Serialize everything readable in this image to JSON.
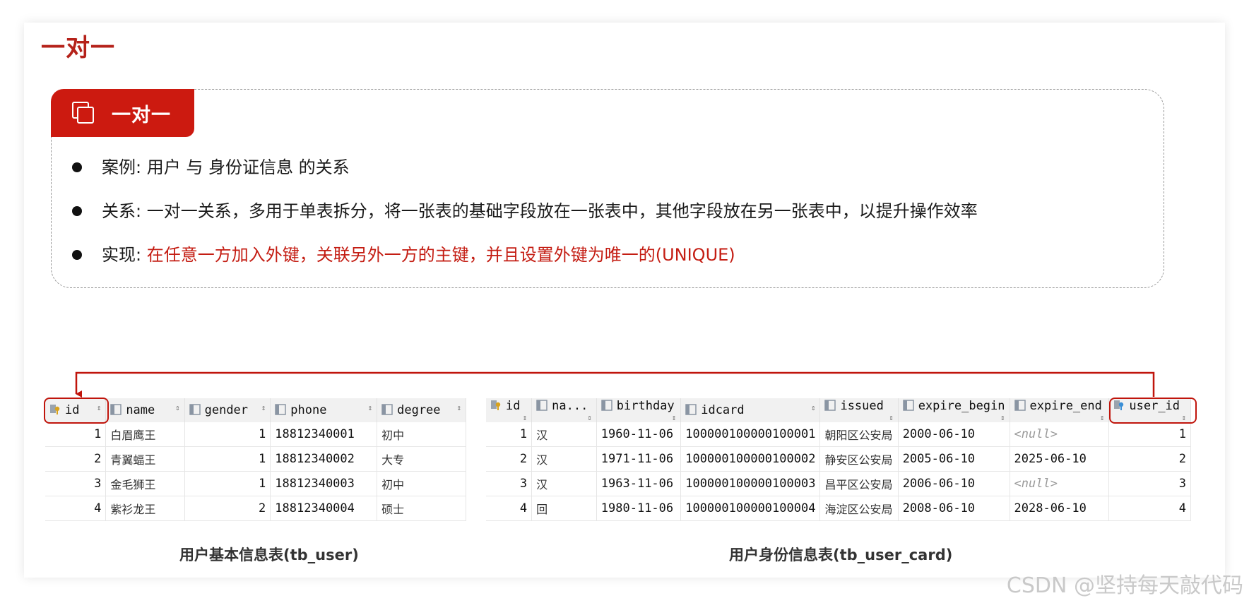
{
  "slide": {
    "title": "一对一",
    "card_label": "一对一",
    "bullets": [
      {
        "prefix": "案例: ",
        "text": "用户 与 身份证信息 的关系",
        "highlight": ""
      },
      {
        "prefix": "关系: ",
        "text": "一对一关系，多用于单表拆分，将一张表的基础字段放在一张表中，其他字段放在另一张表中，以提升操作效率",
        "highlight": ""
      },
      {
        "prefix": "实现: ",
        "text": "",
        "highlight": "在任意一方加入外键，关联另外一方的主键，并且设置外键为唯一的(UNIQUE)"
      }
    ]
  },
  "tb_user": {
    "caption": "用户基本信息表(tb_user)",
    "columns": [
      "id",
      "name",
      "gender",
      "phone",
      "degree"
    ],
    "rows": [
      [
        "1",
        "白眉鹰王",
        "1",
        "18812340001",
        "初中"
      ],
      [
        "2",
        "青翼蝠王",
        "1",
        "18812340002",
        "大专"
      ],
      [
        "3",
        "金毛狮王",
        "1",
        "18812340003",
        "初中"
      ],
      [
        "4",
        "紫衫龙王",
        "2",
        "18812340004",
        "硕士"
      ]
    ]
  },
  "tb_user_card": {
    "caption": "用户身份信息表(tb_user_card)",
    "columns": [
      "id",
      "na...",
      "birthday",
      "idcard",
      "issued",
      "expire_begin",
      "expire_end",
      "user_id"
    ],
    "rows": [
      [
        "1",
        "汉",
        "1960-11-06",
        "100000100000100001",
        "朝阳区公安局",
        "2000-06-10",
        "<null>",
        "1"
      ],
      [
        "2",
        "汉",
        "1971-11-06",
        "100000100000100002",
        "静安区公安局",
        "2005-06-10",
        "2025-06-10",
        "2"
      ],
      [
        "3",
        "汉",
        "1963-11-06",
        "100000100000100003",
        "昌平区公安局",
        "2006-06-10",
        "<null>",
        "3"
      ],
      [
        "4",
        "回",
        "1980-11-06",
        "100000100000100004",
        "海淀区公安局",
        "2008-06-10",
        "2028-06-10",
        "4"
      ]
    ]
  },
  "watermark": "CSDN @坚持每天敲代码",
  "colors": {
    "accent": "#cc1a10",
    "highlight_text": "#c41d13"
  }
}
